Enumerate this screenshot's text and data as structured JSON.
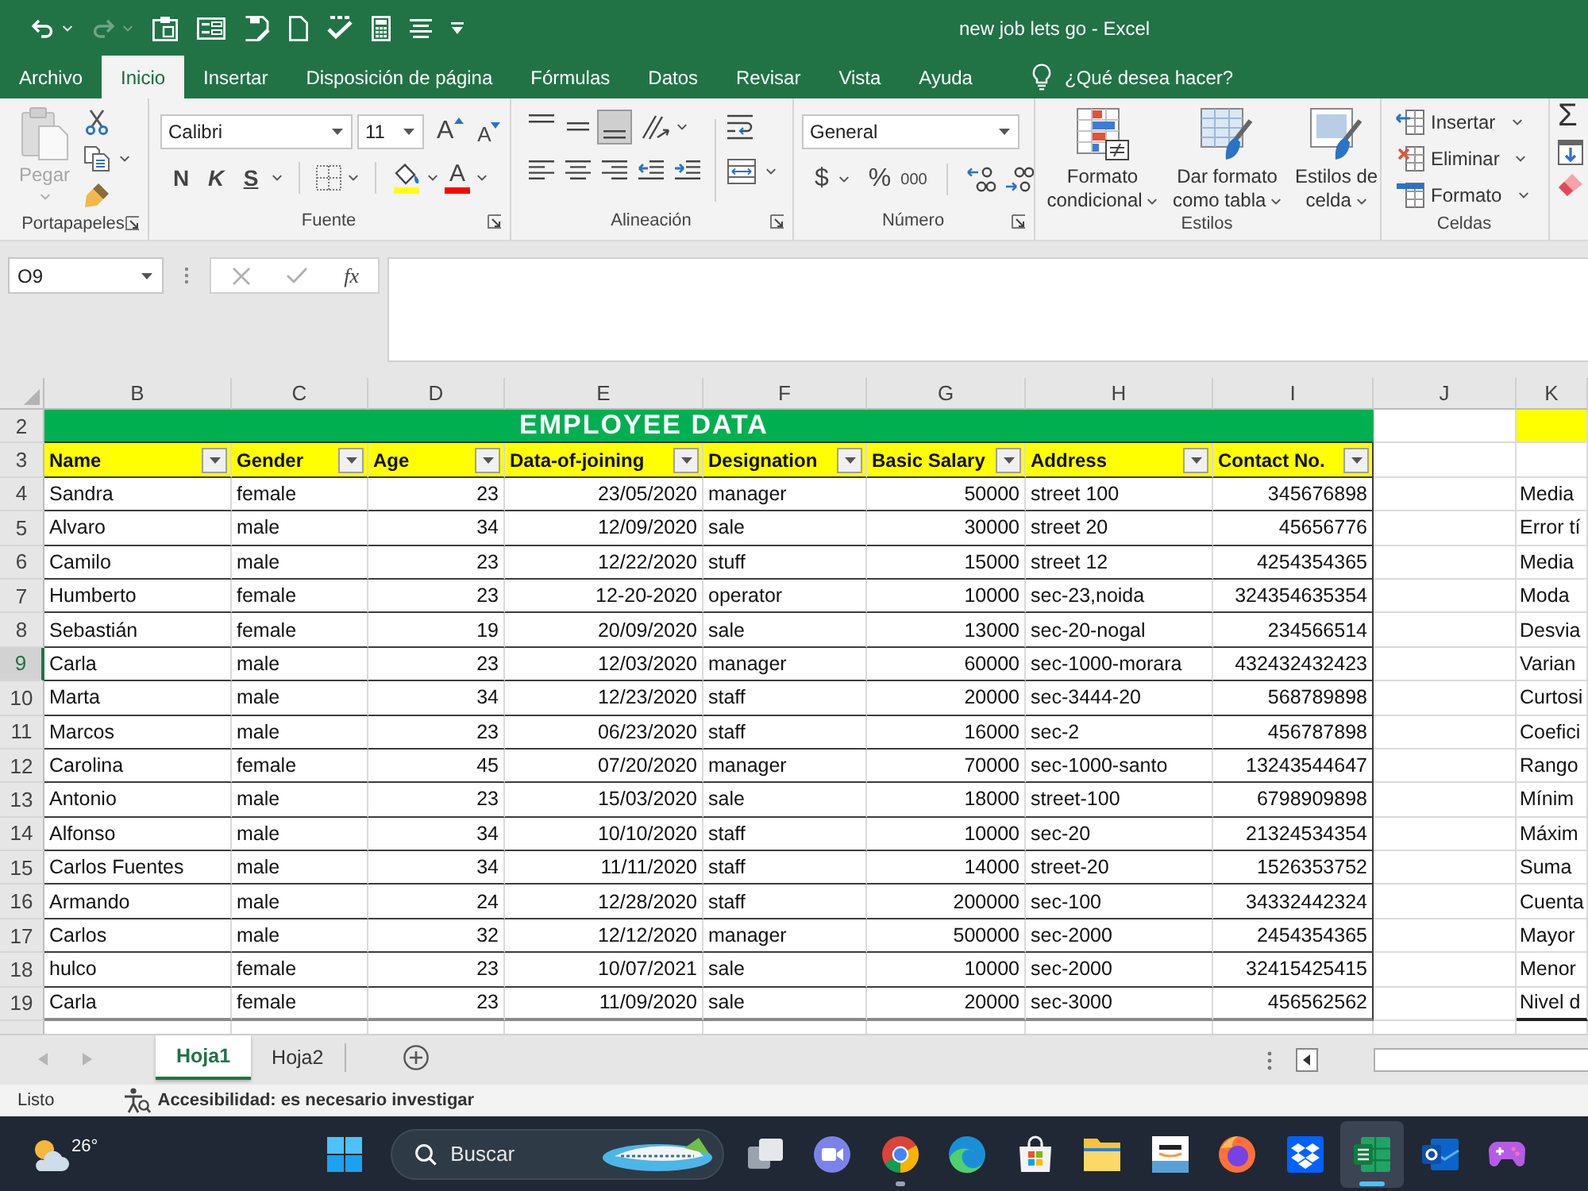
{
  "window": {
    "title": "new job lets go - Excel"
  },
  "quick_access": [
    {
      "kind": "undo",
      "disabled": false
    },
    {
      "kind": "redo",
      "disabled": true
    },
    {
      "kind": "clipboard",
      "disabled": false
    },
    {
      "kind": "form",
      "disabled": false
    },
    {
      "kind": "save",
      "disabled": false
    },
    {
      "kind": "page",
      "disabled": false
    },
    {
      "kind": "spelling",
      "disabled": false
    },
    {
      "kind": "calculator",
      "disabled": false
    },
    {
      "kind": "lines",
      "disabled": false
    },
    {
      "kind": "customize",
      "disabled": false
    }
  ],
  "ribbon_tabs": [
    {
      "label": "Archivo",
      "selected": false
    },
    {
      "label": "Inicio",
      "selected": true
    },
    {
      "label": "Insertar",
      "selected": false
    },
    {
      "label": "Disposición de página",
      "selected": false
    },
    {
      "label": "Fórmulas",
      "selected": false
    },
    {
      "label": "Datos",
      "selected": false
    },
    {
      "label": "Revisar",
      "selected": false
    },
    {
      "label": "Vista",
      "selected": false
    },
    {
      "label": "Ayuda",
      "selected": false
    }
  ],
  "tell_me": {
    "placeholder": "¿Qué desea hacer?"
  },
  "ribbon": {
    "clipboard": {
      "label": "Portapapeles",
      "paste": {
        "label": "Pegar",
        "disabled": true
      }
    },
    "font": {
      "label": "Fuente",
      "font_name": "Calibri",
      "font_size": "11",
      "grow": "A",
      "shrink": "A",
      "bold": "N",
      "italic": "K",
      "underline": "S",
      "color_buttons": [
        {
          "kind": "fill",
          "color": "#ffff00"
        },
        {
          "kind": "text",
          "label": "A",
          "color": "#ff0000"
        }
      ]
    },
    "alignment": {
      "label": "Alineación",
      "vertical": [
        {
          "kind": "top",
          "selected": false
        },
        {
          "kind": "middle",
          "selected": false
        },
        {
          "kind": "bottom",
          "selected": true
        }
      ],
      "horizontal": [
        {
          "kind": "left",
          "selected": false
        },
        {
          "kind": "center",
          "selected": false
        },
        {
          "kind": "right",
          "selected": false
        }
      ]
    },
    "number": {
      "label": "Número",
      "format": "General",
      "currency": "$",
      "percent": "%",
      "thousands": "000"
    },
    "styles": {
      "label": "Estilos",
      "buttons": [
        {
          "kind": "conditional",
          "label": "Formato condicional"
        },
        {
          "kind": "table",
          "label": "Dar formato como tabla"
        },
        {
          "kind": "cell",
          "label": "Estilos de celda"
        }
      ]
    },
    "cells": {
      "label": "Celdas",
      "buttons": [
        {
          "kind": "insert",
          "label": "Insertar"
        },
        {
          "kind": "delete",
          "label": "Eliminar"
        },
        {
          "kind": "format",
          "label": "Formato"
        }
      ]
    },
    "editing": {
      "autosum": "Σ"
    }
  },
  "formula_bar": {
    "name_box": "O9",
    "function_label": "fx",
    "editing": false
  },
  "sheet": {
    "columns": [
      {
        "label": "B",
        "selected": false
      },
      {
        "label": "C",
        "selected": false
      },
      {
        "label": "D",
        "selected": false
      },
      {
        "label": "E",
        "selected": false
      },
      {
        "label": "F",
        "selected": false
      },
      {
        "label": "G",
        "selected": false
      },
      {
        "label": "H",
        "selected": false
      },
      {
        "label": "I",
        "selected": false
      },
      {
        "label": "J",
        "selected": false
      },
      {
        "label": "K",
        "selected": false
      }
    ],
    "rows": [
      {
        "label": "2",
        "selected": false
      },
      {
        "label": "3",
        "selected": false
      },
      {
        "label": "4",
        "selected": false
      },
      {
        "label": "5",
        "selected": false
      },
      {
        "label": "6",
        "selected": false
      },
      {
        "label": "7",
        "selected": false
      },
      {
        "label": "8",
        "selected": false
      },
      {
        "label": "9",
        "selected": true
      },
      {
        "label": "10",
        "selected": false
      },
      {
        "label": "11",
        "selected": false
      },
      {
        "label": "12",
        "selected": false
      },
      {
        "label": "13",
        "selected": false
      },
      {
        "label": "14",
        "selected": false
      },
      {
        "label": "15",
        "selected": false
      },
      {
        "label": "16",
        "selected": false
      },
      {
        "label": "17",
        "selected": false
      },
      {
        "label": "18",
        "selected": false
      },
      {
        "label": "19",
        "selected": false
      }
    ]
  },
  "employee_table": {
    "title": "EMPLOYEE DATA",
    "columns": [
      {
        "label": "Name",
        "kind": "text"
      },
      {
        "label": "Gender",
        "kind": "text"
      },
      {
        "label": "Age",
        "kind": "number"
      },
      {
        "label": "Data-of-joining",
        "kind": "number"
      },
      {
        "label": "Designation",
        "kind": "text"
      },
      {
        "label": "Basic Salary",
        "kind": "number"
      },
      {
        "label": "Address",
        "kind": "text"
      },
      {
        "label": "Contact No.",
        "kind": "number"
      }
    ],
    "rows": [
      [
        "Sandra",
        "female",
        "23",
        "23/05/2020",
        "manager",
        "50000",
        "street 100",
        "345676898"
      ],
      [
        "Alvaro",
        "male",
        "34",
        "12/09/2020",
        "sale",
        "30000",
        "street 20",
        "45656776"
      ],
      [
        "Camilo",
        "male",
        "23",
        "12/22/2020",
        "stuff",
        "15000",
        "street 12",
        "4254354365"
      ],
      [
        "Humberto",
        "female",
        "23",
        "12-20-2020",
        "operator",
        "10000",
        "sec-23,noida",
        "324354635354"
      ],
      [
        "Sebastián",
        "female",
        "19",
        "20/09/2020",
        "sale",
        "13000",
        "sec-20-nogal",
        "234566514"
      ],
      [
        "Carla",
        "male",
        "23",
        "12/03/2020",
        "manager",
        "60000",
        "sec-1000-morara",
        "432432432423"
      ],
      [
        "Marta",
        "male",
        "34",
        "12/23/2020",
        "staff",
        "20000",
        "sec-3444-20",
        "568789898"
      ],
      [
        "Marcos",
        "male",
        "23",
        "06/23/2020",
        "staff",
        "16000",
        "sec-2",
        "456787898"
      ],
      [
        "Carolina",
        "female",
        "45",
        "07/20/2020",
        "manager",
        "70000",
        "sec-1000-santo",
        "13243544647"
      ],
      [
        "Antonio",
        "male",
        "23",
        "15/03/2020",
        "sale",
        "18000",
        "street-100",
        "6798909898"
      ],
      [
        "Alfonso",
        "male",
        "34",
        "10/10/2020",
        "staff",
        "10000",
        "sec-20",
        "21324534354"
      ],
      [
        "Carlos Fuentes",
        "male",
        "34",
        "11/11/2020",
        "staff",
        "14000",
        "street-20",
        "1526353752"
      ],
      [
        "Armando",
        "male",
        "24",
        "12/28/2020",
        "staff",
        "200000",
        "sec-100",
        "34332442324"
      ],
      [
        "Carlos",
        "male",
        "32",
        "12/12/2020",
        "manager",
        "500000",
        "sec-2000",
        "2454354365"
      ],
      [
        "hulco",
        "female",
        "23",
        "10/07/2021",
        "sale",
        "10000",
        "sec-2000",
        "32415425415"
      ],
      [
        "Carla",
        "female",
        "23",
        "11/09/2020",
        "sale",
        "20000",
        "sec-3000",
        "456562562"
      ]
    ]
  },
  "stats_column": {
    "labels": [
      "Media",
      "Error tí",
      "Media",
      "Moda",
      "Desvia",
      "Varian",
      "Curtosi",
      "Coefici",
      "Rango",
      "Mínim",
      "Máxim",
      "Suma",
      "Cuenta",
      "Mayor",
      "Menor",
      "Nivel d"
    ]
  },
  "sheet_tabs": {
    "nav_disabled": true,
    "tabs": [
      {
        "label": "Hoja1",
        "selected": true
      },
      {
        "label": "Hoja2",
        "selected": false
      }
    ]
  },
  "status_bar": {
    "status": "Listo",
    "accessibility": "Accesibilidad: es necesario investigar"
  },
  "taskbar": {
    "weather": "26°",
    "search": {
      "placeholder": "Buscar"
    },
    "apps": [
      {
        "kind": "task_view",
        "running": false,
        "active": false
      },
      {
        "kind": "video_call",
        "running": false,
        "active": false
      },
      {
        "kind": "browser_round",
        "running": true,
        "active": false
      },
      {
        "kind": "browser_wave",
        "running": false,
        "active": false
      },
      {
        "kind": "store",
        "running": false,
        "active": false
      },
      {
        "kind": "files",
        "running": false,
        "active": false
      },
      {
        "kind": "shop",
        "running": false,
        "active": false
      },
      {
        "kind": "browser_fox",
        "running": false,
        "active": false
      },
      {
        "kind": "cloud_box",
        "running": false,
        "active": false
      },
      {
        "kind": "spreadsheet",
        "running": true,
        "active": true
      },
      {
        "kind": "mail",
        "running": false,
        "active": false
      },
      {
        "kind": "game",
        "running": false,
        "active": false
      }
    ]
  }
}
